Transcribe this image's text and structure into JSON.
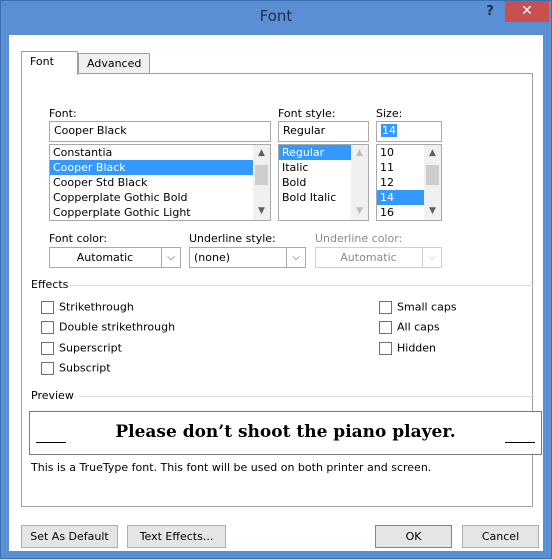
{
  "window": {
    "title": "Font",
    "help_label": "?",
    "close_label": "✕"
  },
  "tabs": [
    {
      "label": "Font"
    },
    {
      "label": "Advanced"
    }
  ],
  "font": {
    "label": "Font:",
    "value": "Cooper Black",
    "items": [
      "Constantia",
      "Cooper Black",
      "Cooper Std Black",
      "Copperplate Gothic Bold",
      "Copperplate Gothic Light"
    ],
    "selected": "Cooper Black"
  },
  "font_style": {
    "label": "Font style:",
    "value": "Regular",
    "items": [
      "Regular",
      "Italic",
      "Bold",
      "Bold Italic"
    ],
    "selected": "Regular"
  },
  "size": {
    "label": "Size:",
    "value": "14",
    "items": [
      "10",
      "11",
      "12",
      "14",
      "16"
    ],
    "selected": "14"
  },
  "font_color": {
    "label": "Font color:",
    "value": "Automatic"
  },
  "underline_style": {
    "label": "Underline style:",
    "value": "(none)"
  },
  "underline_color": {
    "label": "Underline color:",
    "value": "Automatic"
  },
  "effects": {
    "label": "Effects",
    "left": [
      "Strikethrough",
      "Double strikethrough",
      "Superscript",
      "Subscript"
    ],
    "right": [
      "Small caps",
      "All caps",
      "Hidden"
    ]
  },
  "preview": {
    "label": "Preview",
    "sample": "Please don’t shoot the piano player.",
    "note": "This is a TrueType font. This font will be used on both printer and screen."
  },
  "buttons": {
    "set_default": "Set As Default",
    "text_effects": "Text Effects...",
    "ok": "OK",
    "cancel": "Cancel"
  },
  "colors": {
    "title_bar": "#5b8fd4",
    "close": "#c75050",
    "selection": "#3399ff"
  }
}
